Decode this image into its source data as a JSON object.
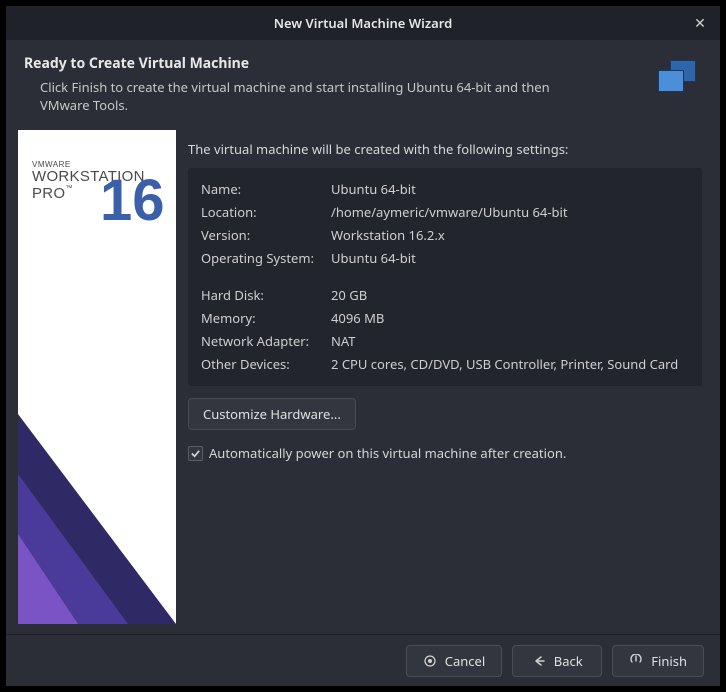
{
  "window": {
    "title": "New Virtual Machine Wizard"
  },
  "header": {
    "heading": "Ready to Create Virtual Machine",
    "description": "Click Finish to create the virtual machine and start installing Ubuntu 64-bit and then VMware Tools."
  },
  "sidebar_brand": {
    "line1": "VMWARE",
    "line2": "WORKSTATION",
    "line3": "PRO",
    "version": "16"
  },
  "intro": "The virtual machine will be created with the following settings:",
  "settings_group1": [
    {
      "key": "Name:",
      "value": "Ubuntu 64-bit"
    },
    {
      "key": "Location:",
      "value": "/home/aymeric/vmware/Ubuntu 64-bit"
    },
    {
      "key": "Version:",
      "value": "Workstation 16.2.x"
    },
    {
      "key": "Operating System:",
      "value": "Ubuntu 64-bit"
    }
  ],
  "settings_group2": [
    {
      "key": "Hard Disk:",
      "value": "20 GB"
    },
    {
      "key": "Memory:",
      "value": "4096 MB"
    },
    {
      "key": "Network Adapter:",
      "value": "NAT"
    },
    {
      "key": "Other Devices:",
      "value": "2 CPU cores, CD/DVD, USB Controller, Printer, Sound Card"
    }
  ],
  "customize_label": "Customize Hardware...",
  "autopower": {
    "checked": true,
    "label": "Automatically power on this virtual machine after creation."
  },
  "buttons": {
    "cancel": "Cancel",
    "back": "Back",
    "finish": "Finish"
  }
}
